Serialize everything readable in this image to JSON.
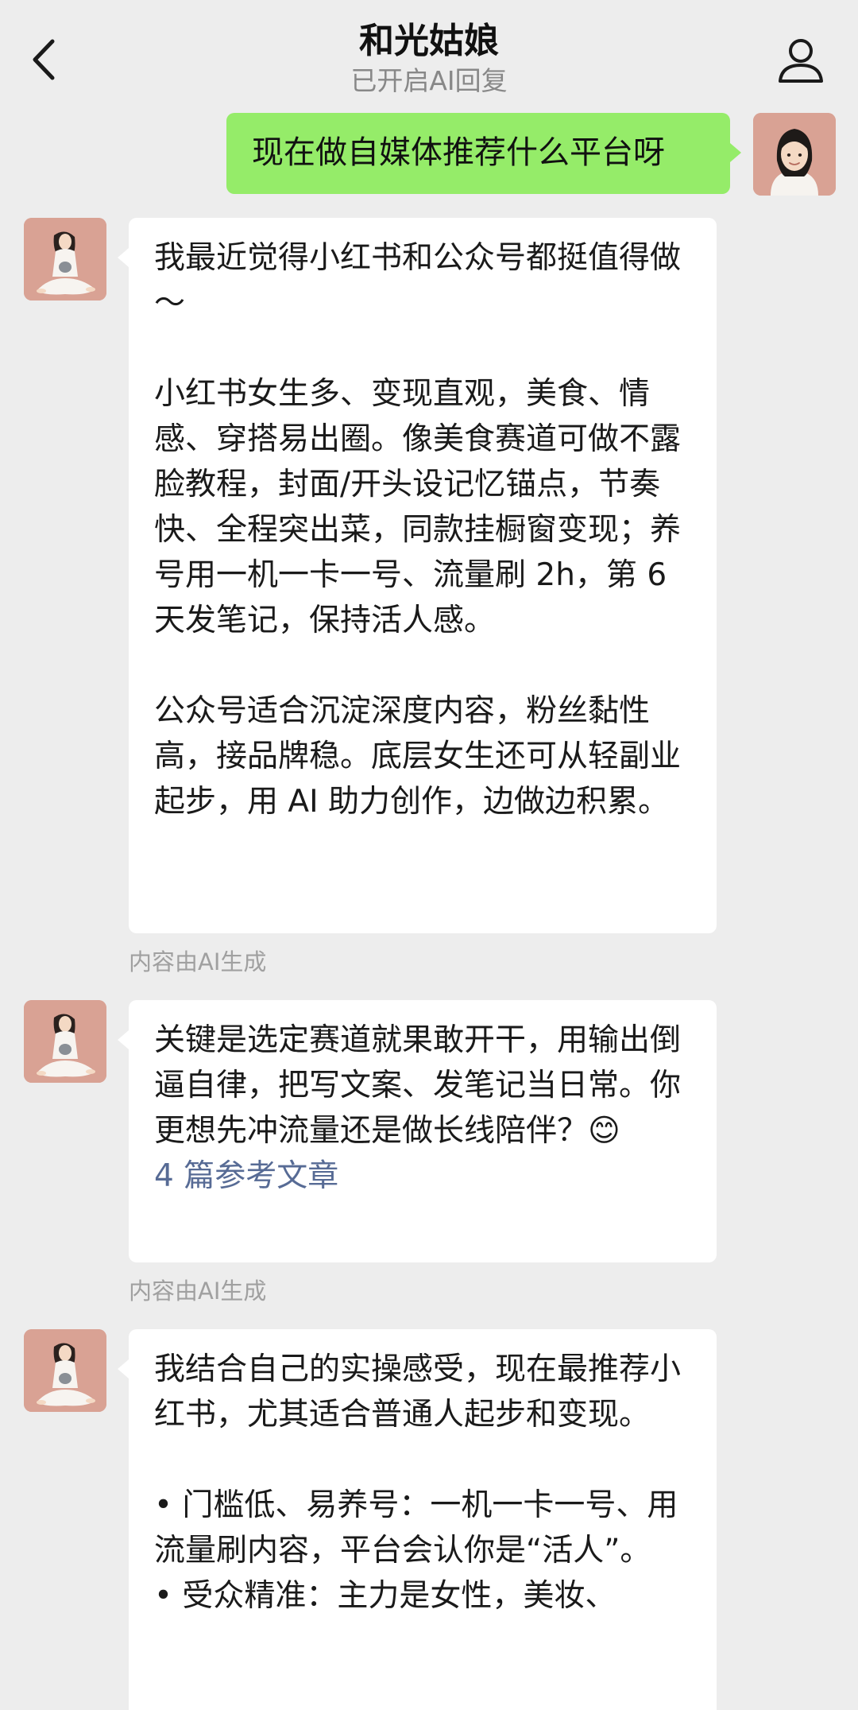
{
  "header": {
    "title": "和光姑娘",
    "subtitle": "已开启AI回复",
    "back_icon": "chevron-left-icon",
    "profile_icon": "person-icon"
  },
  "colors": {
    "background": "#ededed",
    "sent_bubble": "#95ec69",
    "received_bubble": "#ffffff",
    "link": "#576b95",
    "avatar_bg": "#d9a294"
  },
  "messages": [
    {
      "sender": "me",
      "text": "现在做自媒体推荐什么平台呀"
    },
    {
      "sender": "bot",
      "paragraphs": [
        "我最近觉得小红书和公众号都挺值得做～",
        "小红书女生多、变现直观，美食、情感、穿搭易出圈。像美食赛道可做不露脸教程，封面/开头设记忆锚点，节奏快、全程突出菜，同款挂橱窗变现；养号用一机一卡一号、流量刷 2h，第 6 天发笔记，保持活人感。",
        "公众号适合沉淀深度内容，粉丝黏性高，接品牌稳。底层女生还可从轻副业起步，用 AI 助力创作，边做边积累。"
      ],
      "note": "内容由AI生成"
    },
    {
      "sender": "bot",
      "text": "关键是选定赛道就果敢开干，用输出倒逼自律，把写文案、发笔记当日常。你更想先冲流量还是做长线陪伴？😊",
      "reference": "4 篇参考文章",
      "note": "内容由AI生成"
    },
    {
      "sender": "bot",
      "intro": "我结合自己的实操感受，现在最推荐小红书，尤其适合普通人起步和变现。",
      "bullets": [
        "• 门槛低、易养号：一机一卡一号、用流量刷内容，平台会认你是“活人”。",
        "• 受众精准：主力是女性，美妆、"
      ]
    }
  ]
}
